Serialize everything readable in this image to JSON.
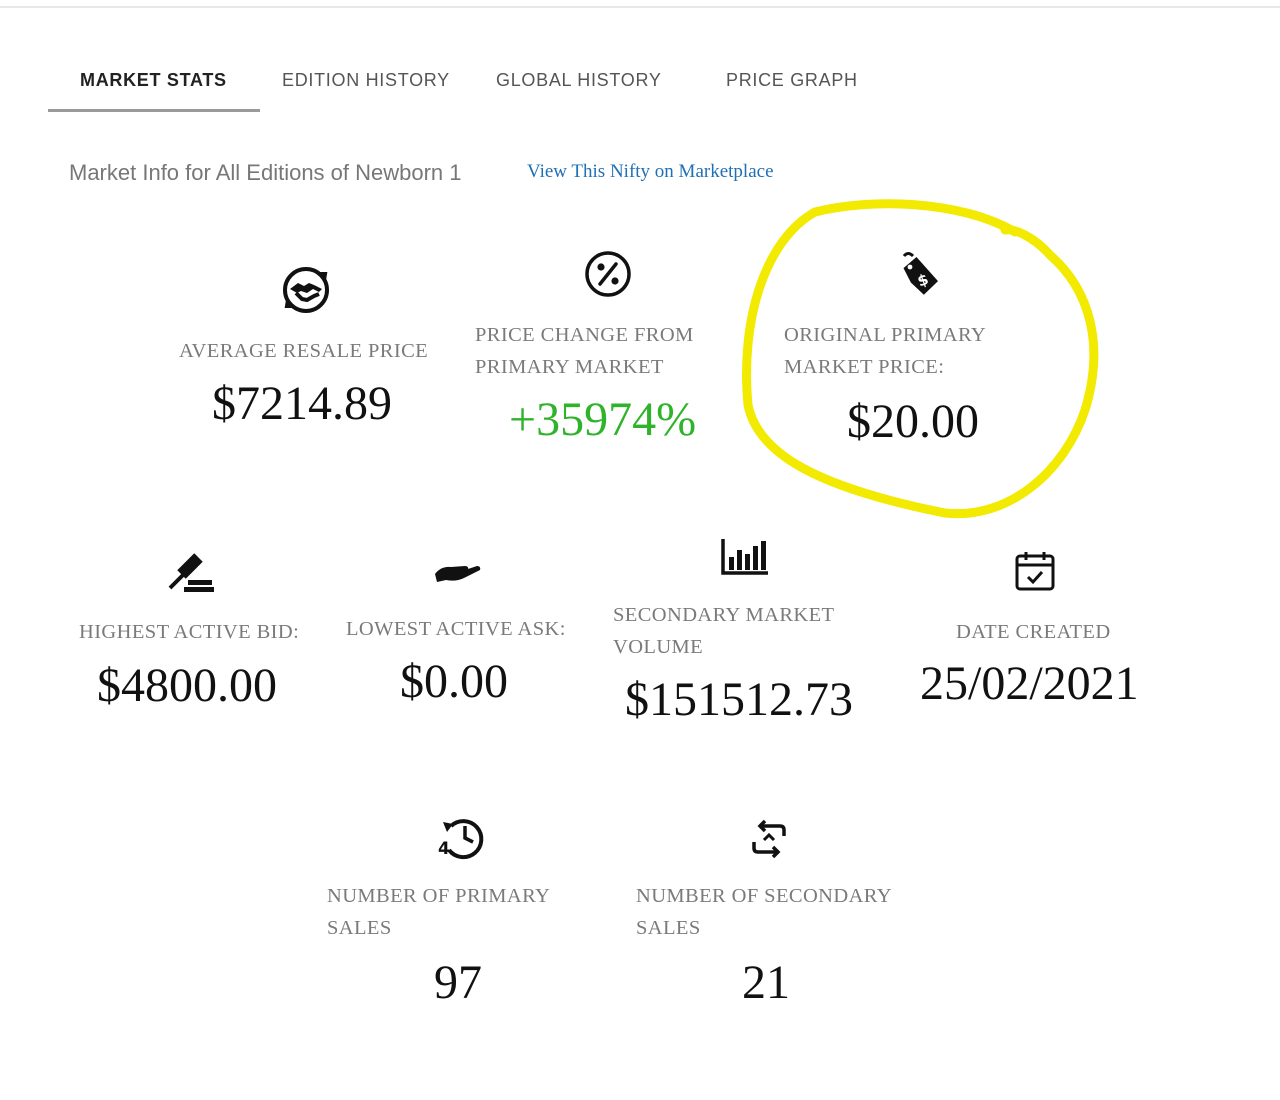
{
  "tabs": [
    {
      "label": "MARKET STATS",
      "active": true
    },
    {
      "label": "EDITION HISTORY",
      "active": false
    },
    {
      "label": "GLOBAL HISTORY",
      "active": false
    },
    {
      "label": "PRICE GRAPH",
      "active": false
    }
  ],
  "header": {
    "subtitle": "Market Info for All Editions of Newborn 1",
    "link": "View This Nifty on Marketplace"
  },
  "stats": {
    "avg_resale": {
      "label": "AVERAGE RESALE PRICE",
      "value": "$7214.89",
      "icon": "handshake-icon"
    },
    "price_change": {
      "label_line1": "PRICE CHANGE FROM",
      "label_line2": "PRIMARY MARKET",
      "value": "+35974%",
      "icon": "percent-icon"
    },
    "original_price": {
      "label_line1": "ORIGINAL PRIMARY",
      "label_line2": "MARKET PRICE:",
      "value": "$20.00",
      "icon": "price-tag-icon"
    },
    "highest_bid": {
      "label": "HIGHEST ACTIVE BID:",
      "value": "$4800.00",
      "icon": "gavel-icon"
    },
    "lowest_ask": {
      "label": "LOWEST ACTIVE ASK:",
      "value": "$0.00",
      "icon": "hand-icon"
    },
    "secondary_volume": {
      "label_line1": "SECONDARY MARKET",
      "label_line2": "VOLUME",
      "value": "$151512.73",
      "icon": "bar-chart-icon"
    },
    "date_created": {
      "label": "DATE CREATED",
      "value": "25/02/2021",
      "icon": "calendar-icon"
    },
    "primary_sales": {
      "label_line1": "NUMBER OF PRIMARY",
      "label_line2": "SALES",
      "value": "97",
      "icon": "history-icon"
    },
    "secondary_sales": {
      "label_line1": "NUMBER OF SECONDARY",
      "label_line2": "SALES",
      "value": "21",
      "icon": "exchange-icon"
    }
  },
  "colors": {
    "positive": "#2fb32a",
    "link": "#1f6fb5",
    "highlight": "#f2ea00"
  }
}
